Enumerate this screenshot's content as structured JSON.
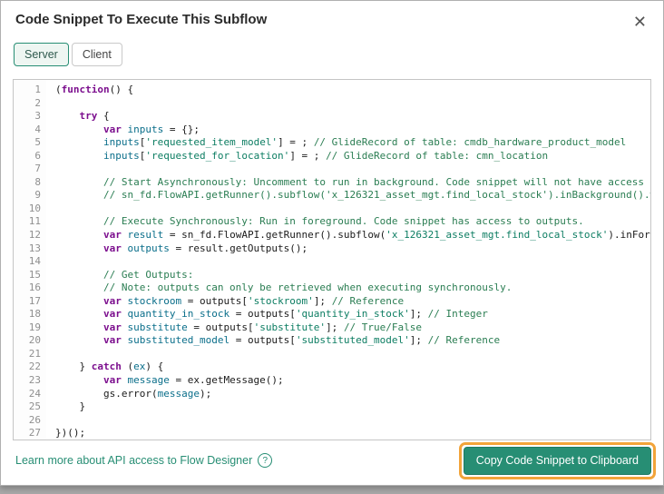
{
  "modal": {
    "title": "Code Snippet To Execute This Subflow",
    "close_glyph": "✕"
  },
  "tabs": [
    {
      "label": "Server",
      "active": true
    },
    {
      "label": "Client",
      "active": false
    }
  ],
  "editor": {
    "lines": [
      [
        [
          "p",
          "("
        ],
        [
          "k",
          "function"
        ],
        [
          "p",
          "() {"
        ]
      ],
      [],
      [
        [
          "p",
          "    "
        ],
        [
          "k",
          "try"
        ],
        [
          "p",
          " {"
        ]
      ],
      [
        [
          "p",
          "        "
        ],
        [
          "k",
          "var"
        ],
        [
          "p",
          " "
        ],
        [
          "d",
          "inputs"
        ],
        [
          "p",
          " = {};"
        ]
      ],
      [
        [
          "p",
          "        "
        ],
        [
          "d",
          "inputs"
        ],
        [
          "p",
          "["
        ],
        [
          "s",
          "'requested_item_model'"
        ],
        [
          "p",
          "] = ; "
        ],
        [
          "c",
          "// GlideRecord of table: cmdb_hardware_product_model"
        ]
      ],
      [
        [
          "p",
          "        "
        ],
        [
          "d",
          "inputs"
        ],
        [
          "p",
          "["
        ],
        [
          "s",
          "'requested_for_location'"
        ],
        [
          "p",
          "] = ; "
        ],
        [
          "c",
          "// GlideRecord of table: cmn_location"
        ]
      ],
      [],
      [
        [
          "p",
          "        "
        ],
        [
          "c",
          "// Start Asynchronously: Uncomment to run in background. Code snippet will not have access to outputs."
        ]
      ],
      [
        [
          "p",
          "        "
        ],
        [
          "c",
          "// sn_fd.FlowAPI.getRunner().subflow('x_126321_asset_mgt.find_local_stock').inBackground().withInputs(inputs).run();"
        ]
      ],
      [],
      [
        [
          "p",
          "        "
        ],
        [
          "c",
          "// Execute Synchronously: Run in foreground. Code snippet has access to outputs."
        ]
      ],
      [
        [
          "p",
          "        "
        ],
        [
          "k",
          "var"
        ],
        [
          "p",
          " "
        ],
        [
          "d",
          "result"
        ],
        [
          "p",
          " = sn_fd.FlowAPI.getRunner().subflow("
        ],
        [
          "s",
          "'x_126321_asset_mgt.find_local_stock'"
        ],
        [
          "p",
          ").inForeground().withInputs(inputs).run();"
        ]
      ],
      [
        [
          "p",
          "        "
        ],
        [
          "k",
          "var"
        ],
        [
          "p",
          " "
        ],
        [
          "d",
          "outputs"
        ],
        [
          "p",
          " = result.getOutputs();"
        ]
      ],
      [],
      [
        [
          "p",
          "        "
        ],
        [
          "c",
          "// Get Outputs:"
        ]
      ],
      [
        [
          "p",
          "        "
        ],
        [
          "c",
          "// Note: outputs can only be retrieved when executing synchronously."
        ]
      ],
      [
        [
          "p",
          "        "
        ],
        [
          "k",
          "var"
        ],
        [
          "p",
          " "
        ],
        [
          "d",
          "stockroom"
        ],
        [
          "p",
          " = outputs["
        ],
        [
          "s",
          "'stockroom'"
        ],
        [
          "p",
          "]; "
        ],
        [
          "c",
          "// Reference"
        ]
      ],
      [
        [
          "p",
          "        "
        ],
        [
          "k",
          "var"
        ],
        [
          "p",
          " "
        ],
        [
          "d",
          "quantity_in_stock"
        ],
        [
          "p",
          " = outputs["
        ],
        [
          "s",
          "'quantity_in_stock'"
        ],
        [
          "p",
          "]; "
        ],
        [
          "c",
          "// Integer"
        ]
      ],
      [
        [
          "p",
          "        "
        ],
        [
          "k",
          "var"
        ],
        [
          "p",
          " "
        ],
        [
          "d",
          "substitute"
        ],
        [
          "p",
          " = outputs["
        ],
        [
          "s",
          "'substitute'"
        ],
        [
          "p",
          "]; "
        ],
        [
          "c",
          "// True/False"
        ]
      ],
      [
        [
          "p",
          "        "
        ],
        [
          "k",
          "var"
        ],
        [
          "p",
          " "
        ],
        [
          "d",
          "substituted_model"
        ],
        [
          "p",
          " = outputs["
        ],
        [
          "s",
          "'substituted_model'"
        ],
        [
          "p",
          "]; "
        ],
        [
          "c",
          "// Reference"
        ]
      ],
      [],
      [
        [
          "p",
          "    } "
        ],
        [
          "k",
          "catch"
        ],
        [
          "p",
          " ("
        ],
        [
          "d",
          "ex"
        ],
        [
          "p",
          ") {"
        ]
      ],
      [
        [
          "p",
          "        "
        ],
        [
          "k",
          "var"
        ],
        [
          "p",
          " "
        ],
        [
          "d",
          "message"
        ],
        [
          "p",
          " = ex.getMessage();"
        ]
      ],
      [
        [
          "p",
          "        gs.error("
        ],
        [
          "d",
          "message"
        ],
        [
          "p",
          ");"
        ]
      ],
      [
        [
          "p",
          "    }"
        ]
      ],
      [],
      [
        [
          "p",
          "})();"
        ]
      ]
    ]
  },
  "footer": {
    "link_text": "Learn more about API access to Flow Designer",
    "help_glyph": "?",
    "copy_button_label": "Copy Code Snippet to Clipboard"
  },
  "colors": {
    "accent": "#278e74",
    "highlight": "#f2a43a",
    "kw": "#7c0f8e",
    "def": "#0a6e8a",
    "str": "#0c7d62",
    "cmt": "#2a7d52"
  }
}
